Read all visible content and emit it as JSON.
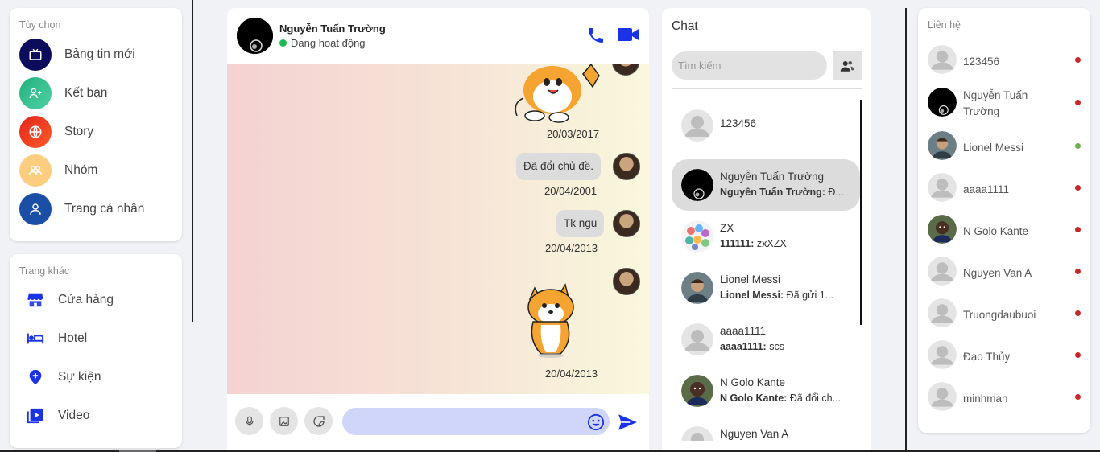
{
  "colors": {
    "accent": "#1a33e8",
    "online": "#1db954",
    "offline": "#c62828",
    "composer_input": "#d0d6fa"
  },
  "menu": {
    "title": "Tùy chọn",
    "items": [
      {
        "label": "Bảng tin mới",
        "icon": "tv-icon"
      },
      {
        "label": "Kết bạn",
        "icon": "add-friend-icon"
      },
      {
        "label": "Story",
        "icon": "globe-icon"
      },
      {
        "label": "Nhóm",
        "icon": "group-icon"
      },
      {
        "label": "Trang cá nhân",
        "icon": "user-icon"
      }
    ]
  },
  "other_pages": {
    "title": "Trang khác",
    "items": [
      {
        "label": "Cửa hàng",
        "icon": "store-icon"
      },
      {
        "label": "Hotel",
        "icon": "bed-icon"
      },
      {
        "label": "Sự kiện",
        "icon": "location-pin-icon"
      },
      {
        "label": "Video",
        "icon": "video-play-icon"
      }
    ]
  },
  "chat": {
    "name": "Nguyễn Tuấn Trường",
    "status": "Đang hoạt động",
    "messages": [
      {
        "type": "sticker",
        "sticker": "shiba-sticker",
        "time": "20/03/2017"
      },
      {
        "type": "text",
        "text": "Đã đổi chủ đề.",
        "time": "20/04/2001"
      },
      {
        "type": "text",
        "text": "Tk ngu",
        "time": "20/04/2013"
      },
      {
        "type": "sticker",
        "sticker": "shiba-sticker",
        "time": "20/04/2013"
      }
    ],
    "composer_placeholder": ""
  },
  "chat_list": {
    "title": "Chat",
    "search_placeholder": "Tìm kiếm",
    "conversations": [
      {
        "name": "123456",
        "sender": "",
        "preview": "",
        "avatar": "default"
      },
      {
        "name": "Nguyễn Tuấn Trường",
        "sender": "Nguyễn Tuấn Trường:",
        "preview": "Đ...",
        "avatar": "dark",
        "active": true
      },
      {
        "name": "ZX",
        "sender": "111111:",
        "preview": "zxXZX",
        "avatar": "group"
      },
      {
        "name": "Lionel Messi",
        "sender": "Lionel Messi:",
        "preview": "Đã gửi 1...",
        "avatar": "photo"
      },
      {
        "name": "aaaa1111",
        "sender": "aaaa1111:",
        "preview": "scs",
        "avatar": "default"
      },
      {
        "name": "N Golo Kante",
        "sender": "N Golo Kante:",
        "preview": "Đã đổi ch...",
        "avatar": "photo-dark"
      },
      {
        "name": "Nguyen Van A",
        "sender": "",
        "preview": "",
        "avatar": "default"
      }
    ]
  },
  "contacts": {
    "title": "Liên hệ",
    "items": [
      {
        "name": "123456",
        "online": false,
        "avatar": "default"
      },
      {
        "name": "Nguyễn Tuấn Trường",
        "online": false,
        "avatar": "dark"
      },
      {
        "name": "Lionel Messi",
        "online": true,
        "avatar": "photo"
      },
      {
        "name": "aaaa1111",
        "online": false,
        "avatar": "default"
      },
      {
        "name": "N Golo Kante",
        "online": false,
        "avatar": "photo-dark"
      },
      {
        "name": "Nguyen Van A",
        "online": false,
        "avatar": "default"
      },
      {
        "name": "Truongdaubuoi",
        "online": false,
        "avatar": "default"
      },
      {
        "name": "Đạo Thủy",
        "online": false,
        "avatar": "default"
      },
      {
        "name": "minhman",
        "online": false,
        "avatar": "default"
      }
    ]
  }
}
